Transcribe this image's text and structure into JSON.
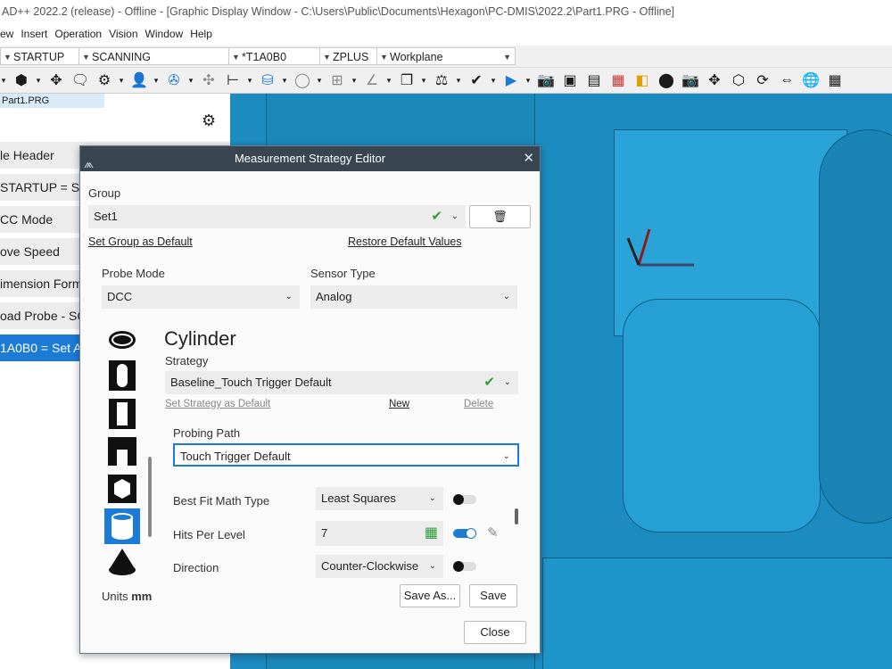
{
  "window": {
    "title": "AD++ 2022.2 (release) - Offline - [Graphic Display Window - C:\\Users\\Public\\Documents\\Hexagon\\PC-DMIS\\2022.2\\Part1.PRG - Offline]"
  },
  "menu": {
    "items": [
      "ew",
      "Insert",
      "Operation",
      "Vision",
      "Window",
      "Help"
    ]
  },
  "combos": {
    "startup": "STARTUP",
    "scanning": "SCANNING",
    "probe_tip": "*T1A0B0",
    "zplus": "ZPLUS",
    "workplane": "Workplane"
  },
  "left_panel": {
    "tab": "Part1.PRG",
    "items": [
      "le Header",
      "STARTUP = Start",
      "CC Mode",
      "ove Speed",
      "imension Form",
      "oad Probe - SC",
      "1A0B0 = Set A"
    ]
  },
  "dialog": {
    "title": "Measurement Strategy Editor",
    "group_label": "Group",
    "group_value": "Set1",
    "set_group_default": "Set Group as Default",
    "restore_defaults": "Restore Default Values",
    "probe_mode_label": "Probe Mode",
    "probe_mode_value": "DCC",
    "sensor_type_label": "Sensor Type",
    "sensor_type_value": "Analog",
    "feature_title": "Cylinder",
    "strategy_label": "Strategy",
    "strategy_value": "Baseline_Touch Trigger Default",
    "set_strategy_default": "Set Strategy as Default",
    "new_link": "New",
    "delete_link": "Delete",
    "probing_path_label": "Probing Path",
    "probing_path_value": "Touch Trigger Default",
    "best_fit_label": "Best Fit Math Type",
    "best_fit_value": "Least Squares",
    "hits_label": "Hits Per Level",
    "hits_value": "7",
    "direction_label": "Direction",
    "direction_value": "Counter-Clockwise",
    "units_label": "Units",
    "units_value": "mm",
    "save_as": "Save As...",
    "save": "Save",
    "close": "Close",
    "toggles": {
      "best_fit": false,
      "hits_per_level": true,
      "direction": false
    }
  },
  "colors": {
    "accent": "#1b7bd6",
    "viewport": "#1c8cc0",
    "dialog_title": "#3a4552",
    "check": "#2e9e3a"
  }
}
